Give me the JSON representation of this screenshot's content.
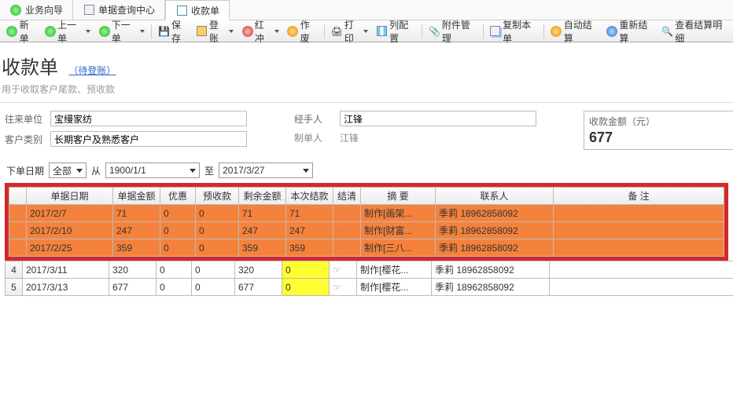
{
  "tabs": [
    {
      "label": "业务向导"
    },
    {
      "label": "单据查询中心"
    },
    {
      "label": "收款单",
      "active": true
    }
  ],
  "toolbar": {
    "new": "新单",
    "prev": "上一单",
    "next": "下一单",
    "save": "保存",
    "post": "登账",
    "red": "红冲",
    "void": "作废",
    "print": "打印",
    "cols": "列配置",
    "attach": "附件管理",
    "copy": "复制本单",
    "auto_settle": "自动结算",
    "re_settle": "重新结算",
    "view_settle": "查看结算明细"
  },
  "page": {
    "title": "收款单",
    "status": "（待登账）",
    "subtitle": "用于收取客户尾款、预收款"
  },
  "form": {
    "partner_label": "往来单位",
    "partner_value": "宝缦家纺",
    "cust_type_label": "客户类别",
    "cust_type_value": "长期客户及熟悉客户",
    "handler_label": "经手人",
    "handler_value": "江锋",
    "creator_label": "制单人",
    "creator_value": "江锋",
    "amount_label": "收款金额（元）",
    "amount_value": "677"
  },
  "filter": {
    "order_date_label": "下单日期",
    "range": "全部",
    "from_label": "从",
    "from": "1900/1/1",
    "to_label": "至",
    "to": "2017/3/27"
  },
  "columns": [
    "",
    "单据日期",
    "单据金额",
    "优惠",
    "预收款",
    "剩余金额",
    "本次结款",
    "结清",
    "摘 要",
    "联系人",
    "备 注"
  ],
  "rows": [
    {
      "hl": true,
      "num": "",
      "date": "2017/2/7",
      "amt": "71",
      "disc": "0",
      "pre": "0",
      "remain": "71",
      "pay": "71",
      "summary": "制作[画架...",
      "contact_name": "季莉",
      "contact_phone": "18962858092",
      "note": ""
    },
    {
      "hl": true,
      "num": "",
      "date": "2017/2/10",
      "amt": "247",
      "disc": "0",
      "pre": "0",
      "remain": "247",
      "pay": "247",
      "summary": "制作[财富...",
      "contact_name": "季莉",
      "contact_phone": "18962858092",
      "note": ""
    },
    {
      "hl": true,
      "num": "",
      "date": "2017/2/25",
      "amt": "359",
      "disc": "0",
      "pre": "0",
      "remain": "359",
      "pay": "359",
      "summary": "制作[三八...",
      "contact_name": "季莉",
      "contact_phone": "18962858092",
      "note": ""
    },
    {
      "hl": false,
      "num": "4",
      "date": "2017/3/11",
      "amt": "320",
      "disc": "0",
      "pre": "0",
      "remain": "320",
      "pay": "0",
      "pay_yellow": true,
      "summary": "制作[樱花...",
      "contact_name": "季莉",
      "contact_phone": "18962858092",
      "note": ""
    },
    {
      "hl": false,
      "num": "5",
      "date": "2017/3/13",
      "amt": "677",
      "disc": "0",
      "pre": "0",
      "remain": "677",
      "pay": "0",
      "pay_yellow": true,
      "summary": "制作[樱花...",
      "contact_name": "季莉",
      "contact_phone": "18962858092",
      "note": ""
    }
  ]
}
